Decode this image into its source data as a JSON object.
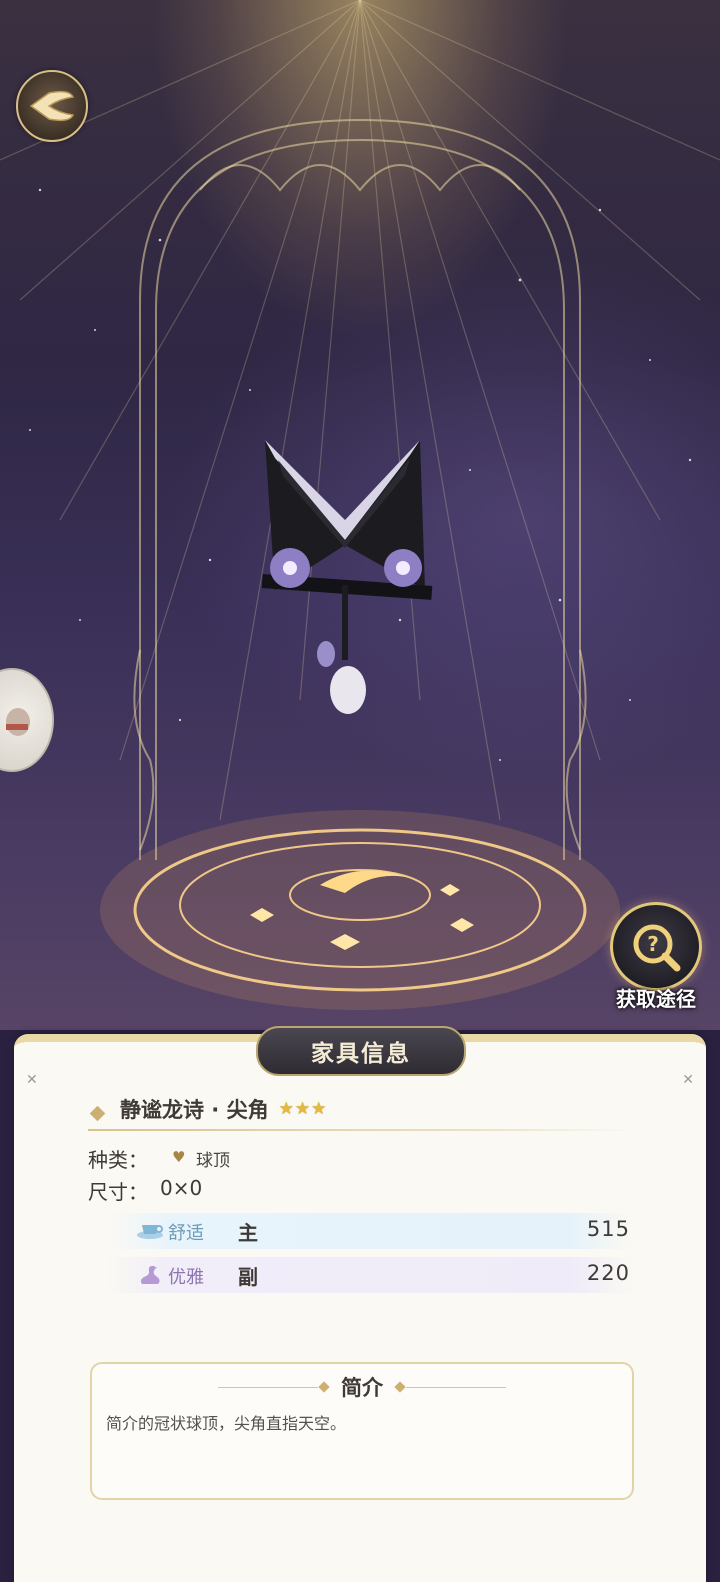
{
  "header": {
    "back_icon": "back-wing-icon"
  },
  "acquire": {
    "label": "获取途径",
    "icon": "magnifier-question-icon"
  },
  "panel": {
    "title": "家具信息",
    "item_name": "静谧龙诗 · 尖角",
    "rarity": "3",
    "type_label": "种类：",
    "type_value": "球顶",
    "type_icon": "dome-icon",
    "size_label": "尺寸：",
    "size_value": "0×0",
    "stats": [
      {
        "name": "舒适",
        "role": "主",
        "value": "515",
        "icon": "teacup-icon",
        "color": "#6c9bb8"
      },
      {
        "name": "优雅",
        "role": "副",
        "value": "220",
        "icon": "swan-icon",
        "color": "#8d76ad"
      }
    ],
    "intro_title": "简介",
    "intro_text": "简介的冠状球顶，尖角直指天空。"
  },
  "colors": {
    "accent_gold": "#d8bf86",
    "panel_bg": "#fbf9f3",
    "star": "#e7b93b"
  }
}
